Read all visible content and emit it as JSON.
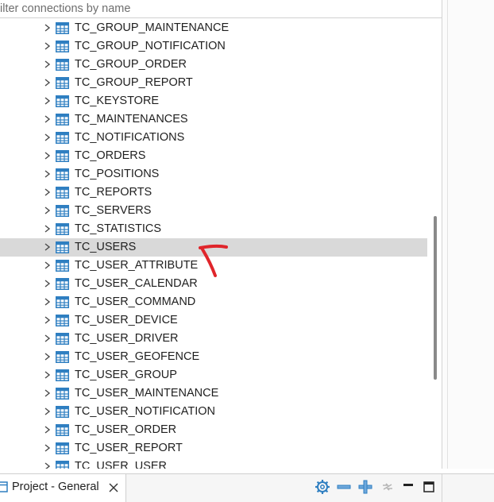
{
  "filter": {
    "placeholder": "ilter connections by name",
    "value": ""
  },
  "tree": {
    "rows": [
      {
        "label": "TC_GROUP_MAINTENANCE",
        "selected": false
      },
      {
        "label": "TC_GROUP_NOTIFICATION",
        "selected": false
      },
      {
        "label": "TC_GROUP_ORDER",
        "selected": false
      },
      {
        "label": "TC_GROUP_REPORT",
        "selected": false
      },
      {
        "label": "TC_KEYSTORE",
        "selected": false
      },
      {
        "label": "TC_MAINTENANCES",
        "selected": false
      },
      {
        "label": "TC_NOTIFICATIONS",
        "selected": false
      },
      {
        "label": "TC_ORDERS",
        "selected": false
      },
      {
        "label": "TC_POSITIONS",
        "selected": false
      },
      {
        "label": "TC_REPORTS",
        "selected": false
      },
      {
        "label": "TC_SERVERS",
        "selected": false
      },
      {
        "label": "TC_STATISTICS",
        "selected": false
      },
      {
        "label": "TC_USERS",
        "selected": true
      },
      {
        "label": "TC_USER_ATTRIBUTE",
        "selected": false
      },
      {
        "label": "TC_USER_CALENDAR",
        "selected": false
      },
      {
        "label": "TC_USER_COMMAND",
        "selected": false
      },
      {
        "label": "TC_USER_DEVICE",
        "selected": false
      },
      {
        "label": "TC_USER_DRIVER",
        "selected": false
      },
      {
        "label": "TC_USER_GEOFENCE",
        "selected": false
      },
      {
        "label": "TC_USER_GROUP",
        "selected": false
      },
      {
        "label": "TC_USER_MAINTENANCE",
        "selected": false
      },
      {
        "label": "TC_USER_NOTIFICATION",
        "selected": false
      },
      {
        "label": "TC_USER_ORDER",
        "selected": false
      },
      {
        "label": "TC_USER_REPORT",
        "selected": false
      },
      {
        "label": "TC_USER_USER",
        "selected": false
      }
    ],
    "row_icon": "table-icon",
    "expander_icon": "chevron-right-icon",
    "selected_color": "#d9d9d9"
  },
  "annotation": {
    "icon": "red-arrow-icon",
    "color": "#e0252b"
  },
  "bottom_panel": {
    "tab_label": "Project - General",
    "tab_icon": "project-icon",
    "tools": [
      "gear-icon",
      "collapse-icon",
      "expand-icon",
      "link-icon",
      "minimize-icon",
      "maximize-icon"
    ],
    "accent": "#2f7fc1"
  }
}
